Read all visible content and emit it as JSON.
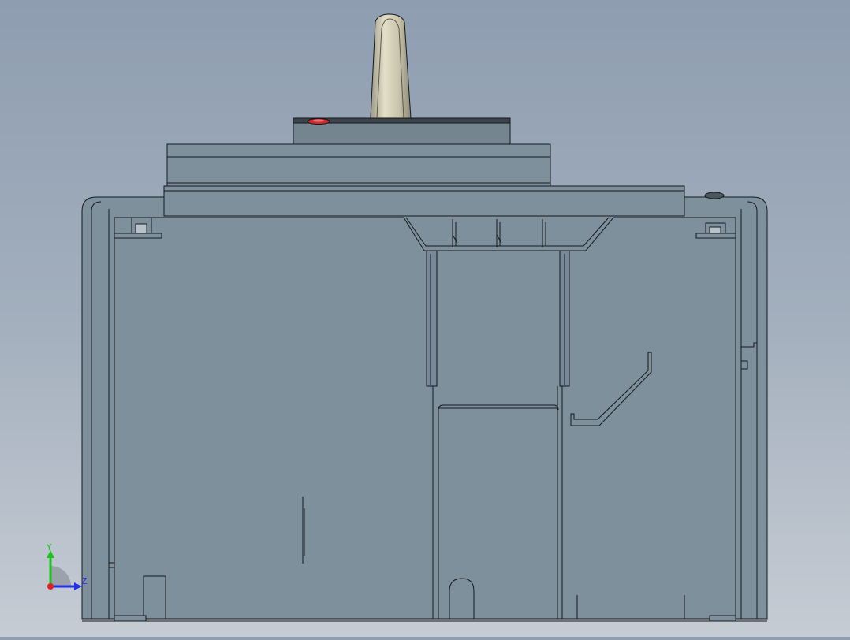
{
  "viewport": {
    "background_top": "#8e9db0",
    "background_bottom": "#c6ccd4"
  },
  "model": {
    "body_color": "#7e909c",
    "body_dark": "#6f808c",
    "edge_color": "#14181c",
    "handle_color": "#cfcab2",
    "button_color": "#d42a2a"
  },
  "triad": {
    "y_label": "Y",
    "z_label": "Z",
    "y_color": "#1ec21e",
    "z_color": "#2430e6",
    "origin_color": "#e02020"
  }
}
